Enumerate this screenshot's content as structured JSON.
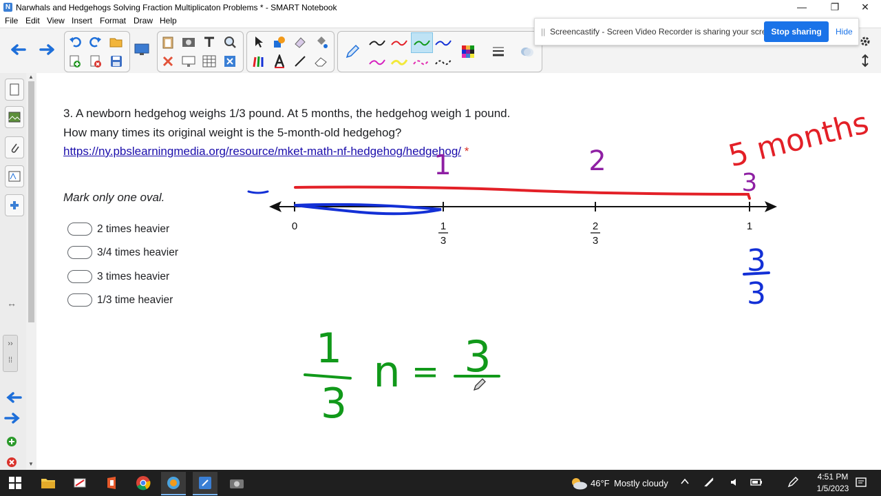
{
  "window": {
    "title": "Narwhals and Hedgehogs Solving Fraction Multiplicaton Problems * - SMART Notebook",
    "minimize": "—",
    "restore": "❐",
    "close": "✕"
  },
  "menu": [
    "File",
    "Edit",
    "View",
    "Insert",
    "Format",
    "Draw",
    "Help"
  ],
  "share_banner": {
    "grip": "||",
    "message": "Screencastify - Screen Video Recorder is sharing your screen.",
    "stop_button": "Stop sharing",
    "hide_link": "Hide"
  },
  "question": {
    "text_before": "3. A newborn hedgehog weighs 1/3 pound. At 5 months, the hedgehog weigh 1 pound. How many times its original weight is the 5-month-old hedgehog?",
    "link": "https://ny.pbslearningmedia.org/resource/mket-math-nf-hedgehog/hedgehog/",
    "required_mark": "*",
    "instruction": "Mark only one oval.",
    "options": [
      "2 times heavier",
      "3/4 times heavier",
      "3 times heavier",
      "1/3 time heavier"
    ]
  },
  "number_line": {
    "labels": {
      "zero": "0",
      "third_num": "1",
      "third_den": "3",
      "two_thirds_num": "2",
      "two_thirds_den": "3",
      "one": "1"
    },
    "ticks": [
      0,
      0.3333,
      0.6667,
      1
    ],
    "handwriting": {
      "jump1": "1",
      "jump2": "2",
      "jump3": "3",
      "five_months": "5 months",
      "blue_num": "3",
      "blue_den": "3",
      "eq_num": "1",
      "eq_den": "3",
      "eq_var": "n",
      "eq_sign": "=",
      "eq_rhs_num": "3"
    },
    "colors": {
      "red": "#e32027",
      "blue": "#1330d6",
      "purple": "#8e1fa3",
      "green": "#11991a"
    }
  },
  "taskbar": {
    "weather_temp": "46°F",
    "weather_desc": "Mostly cloudy",
    "time": "4:51 PM",
    "date": "1/5/2023"
  },
  "icons": [
    "windows-start-icon",
    "file-explorer-icon",
    "cloud-icon",
    "tray-chevron-icon",
    "notification-icon"
  ]
}
